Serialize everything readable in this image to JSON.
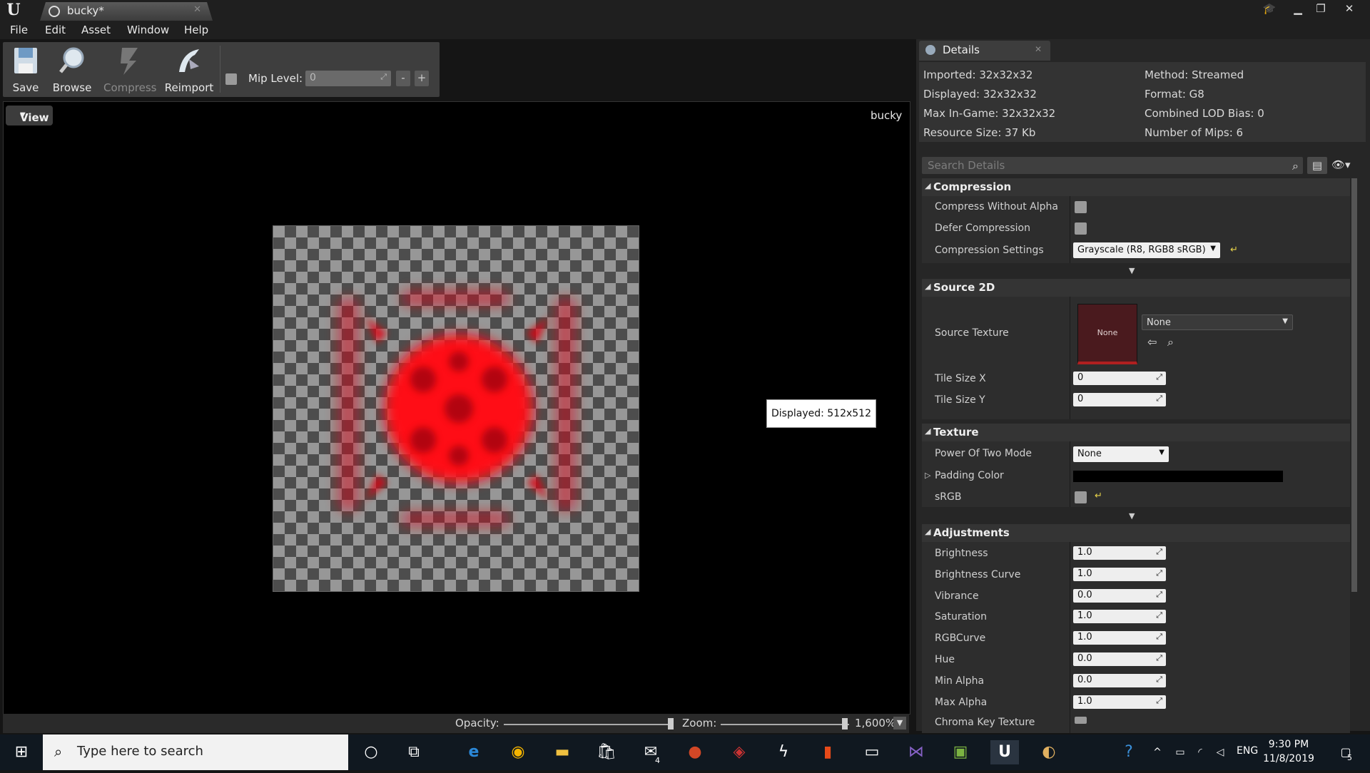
{
  "window": {
    "tab_title": "bucky*"
  },
  "menu": [
    "File",
    "Edit",
    "Asset",
    "Window",
    "Help"
  ],
  "toolbar": {
    "save": "Save",
    "browse": "Browse",
    "compress": "Compress",
    "reimport": "Reimport",
    "mip_label": "Mip Level:",
    "mip_value": "0",
    "minus": "-",
    "plus": "+"
  },
  "viewport": {
    "view_button": "View",
    "asset_name": "bucky",
    "tooltip": "Displayed: 512x512",
    "opacity_label": "Opacity:",
    "zoom_label": "Zoom:",
    "zoom_value": "1,600%"
  },
  "details": {
    "tab": "Details",
    "info": {
      "imported": "Imported: 32x32x32",
      "displayed": "Displayed: 32x32x32",
      "max_ingame": "Max In-Game: 32x32x32",
      "resource_size": "Resource Size: 37 Kb",
      "method": "Method: Streamed",
      "format": "Format: G8",
      "lod_bias": "Combined LOD Bias: 0",
      "num_mips": "Number of Mips: 6"
    },
    "search_placeholder": "Search Details",
    "compression": {
      "title": "Compression",
      "compress_without_alpha": "Compress Without Alpha",
      "defer_compression": "Defer Compression",
      "compression_settings": "Compression Settings",
      "compression_value": "Grayscale (R8, RGB8 sRGB)"
    },
    "source2d": {
      "title": "Source 2D",
      "source_texture": "Source Texture",
      "thumb_text": "None",
      "asset_value": "None",
      "tile_x": "Tile Size X",
      "tile_x_value": "0",
      "tile_y": "Tile Size Y",
      "tile_y_value": "0"
    },
    "texture": {
      "title": "Texture",
      "pow2": "Power Of Two Mode",
      "pow2_value": "None",
      "padding_color": "Padding Color",
      "srgb": "sRGB"
    },
    "adjustments": {
      "title": "Adjustments",
      "rows": [
        {
          "label": "Brightness",
          "value": "1.0"
        },
        {
          "label": "Brightness Curve",
          "value": "1.0"
        },
        {
          "label": "Vibrance",
          "value": "0.0"
        },
        {
          "label": "Saturation",
          "value": "1.0"
        },
        {
          "label": "RGBCurve",
          "value": "1.0"
        },
        {
          "label": "Hue",
          "value": "0.0"
        },
        {
          "label": "Min Alpha",
          "value": "0.0"
        },
        {
          "label": "Max Alpha",
          "value": "1.0"
        }
      ],
      "chroma_key": "Chroma Key Texture"
    }
  },
  "taskbar": {
    "search_placeholder": "Type here to search",
    "mail_badge": "4",
    "lang": "ENG",
    "time": "9:30 PM",
    "date": "11/8/2019",
    "notif": "5"
  }
}
